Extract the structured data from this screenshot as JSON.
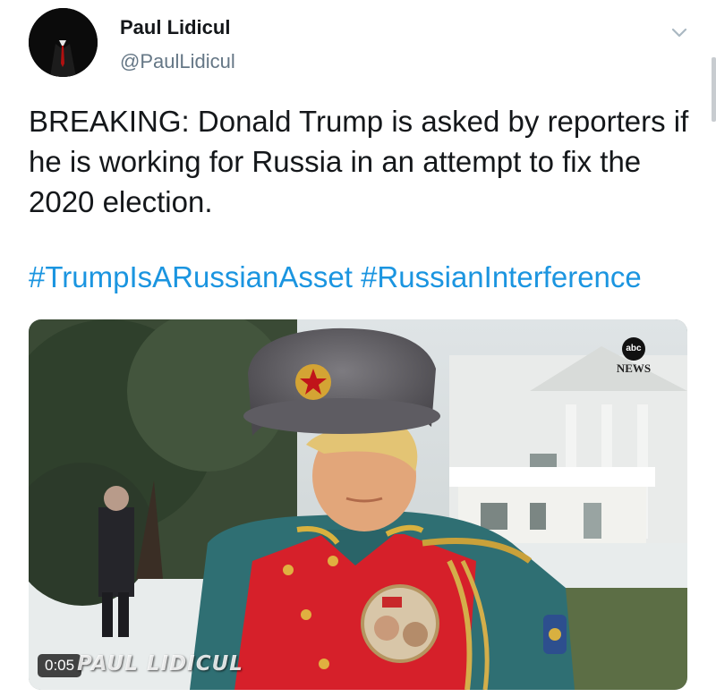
{
  "author": {
    "display_name": "Paul Lidicul",
    "handle": "@PaulLidicul"
  },
  "tweet": {
    "text": "BREAKING: Donald Trump is asked by reporters if he is working for Russia in an attempt to fix the 2020 election.",
    "hashtags": [
      "#TrumpIsARussianAsset",
      "#RussianInterference"
    ]
  },
  "media": {
    "duration": "0:05",
    "watermark": "PAUL LIDICUL",
    "network_logo": {
      "abc": "abc",
      "news": "NEWS"
    },
    "pin_text": "☭"
  },
  "icons": {
    "menu": "chevron-down-icon"
  },
  "colors": {
    "link": "#1b95e0",
    "secondary_text": "#657786",
    "primary_text": "#14171a"
  }
}
